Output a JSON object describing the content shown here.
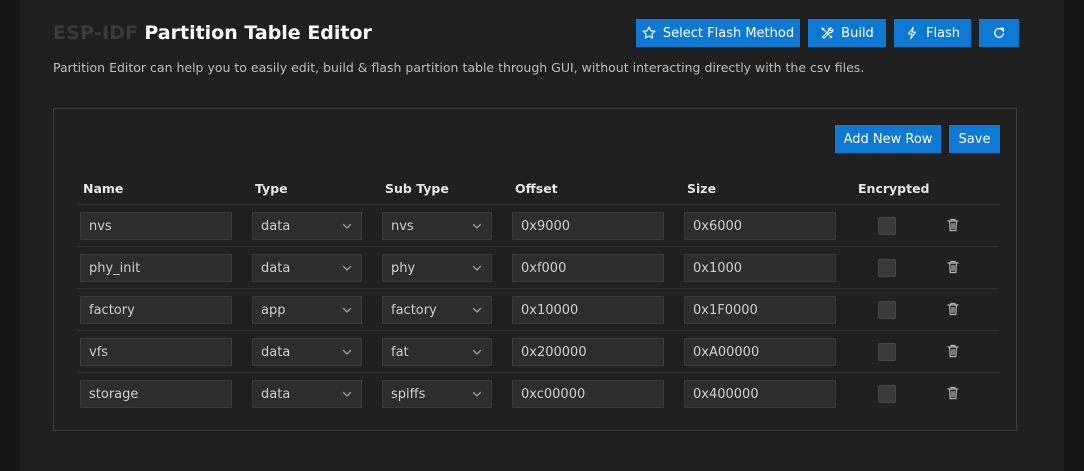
{
  "header": {
    "title_prefix": "ESP-IDF",
    "title": "Partition Table Editor",
    "subtitle": "Partition Editor can help you to easily edit, build & flash partition table through GUI, without interacting directly with the csv files."
  },
  "toolbar": {
    "select_flash_method": "Select Flash Method",
    "build": "Build",
    "flash": "Flash",
    "refresh_icon": "refresh-icon"
  },
  "panel": {
    "add_new_row": "Add New Row",
    "save": "Save"
  },
  "table": {
    "columns": [
      "Name",
      "Type",
      "Sub Type",
      "Offset",
      "Size",
      "Encrypted"
    ],
    "rows": [
      {
        "name": "nvs",
        "type": "data",
        "subtype": "nvs",
        "offset": "0x9000",
        "size": "0x6000",
        "encrypted": false
      },
      {
        "name": "phy_init",
        "type": "data",
        "subtype": "phy",
        "offset": "0xf000",
        "size": "0x1000",
        "encrypted": false
      },
      {
        "name": "factory",
        "type": "app",
        "subtype": "factory",
        "offset": "0x10000",
        "size": "0x1F0000",
        "encrypted": false
      },
      {
        "name": "vfs",
        "type": "data",
        "subtype": "fat",
        "offset": "0x200000",
        "size": "0xA00000",
        "encrypted": false
      },
      {
        "name": "storage",
        "type": "data",
        "subtype": "spiffs",
        "offset": "0xc00000",
        "size": "0x400000",
        "encrypted": false
      }
    ]
  },
  "colors": {
    "accent": "#0e79d3",
    "background": "#1f1f1f",
    "input_bg": "#2d2d2d"
  }
}
